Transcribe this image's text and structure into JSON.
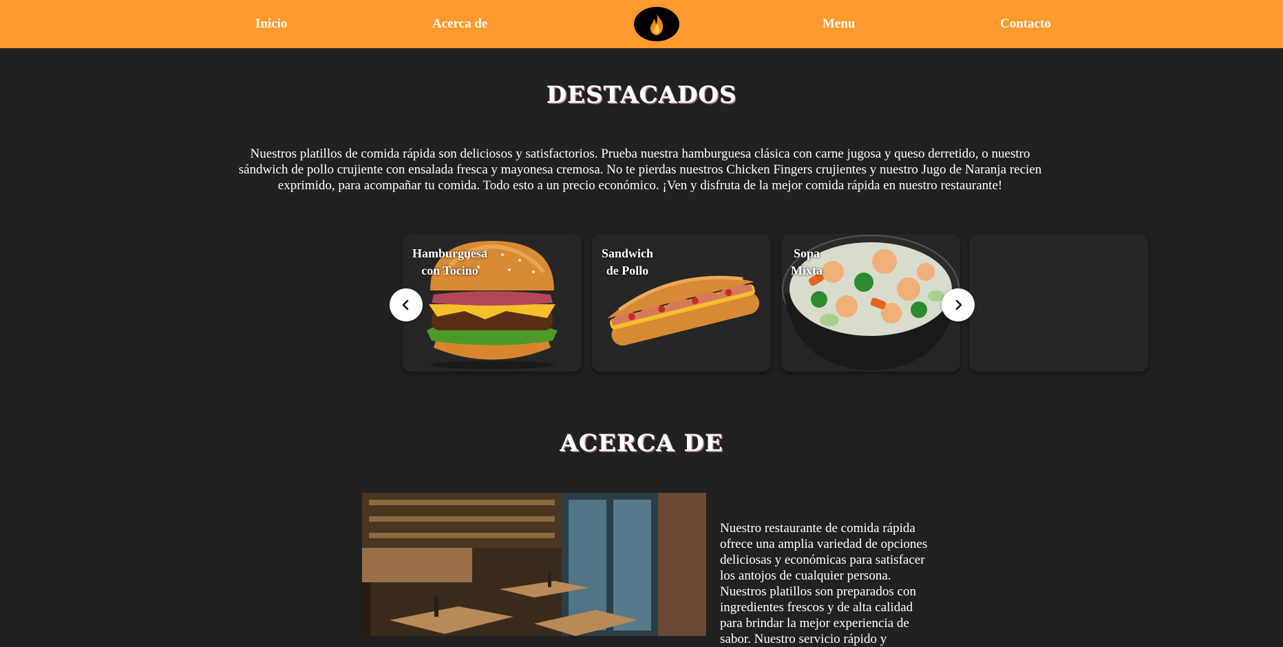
{
  "nav": {
    "items": [
      {
        "label": "Inicio"
      },
      {
        "label": "Acerca de"
      },
      {
        "label": "Menu"
      },
      {
        "label": "Contacto"
      }
    ],
    "logo_icon": "flame-icon",
    "background": "#ff9a2e"
  },
  "featured": {
    "title": "DESTACADOS",
    "description": "Nuestros platillos de comida rápida son deliciosos y satisfactorios. Prueba nuestra hamburguesa clásica con carne jugosa y queso derretido, o nuestro sándwich de pollo crujiente con ensalada fresca y mayonesa cremosa. No te pierdas nuestros Chicken Fingers crujientes y nuestro Jugo de Naranja recien exprimido, para acompañar tu comida. Todo esto a un precio económico. ¡Ven y disfruta de la mejor comida rápida en nuestro restaurante!",
    "cards": [
      {
        "line1": "Hamburguesa",
        "line2": "con Tocino"
      },
      {
        "line1": "Sandwich",
        "line2": "de Pollo"
      },
      {
        "line1": "Sopa",
        "line2": "Mixta"
      }
    ],
    "prev_icon": "chevron-left-icon",
    "next_icon": "chevron-right-icon"
  },
  "about": {
    "title": "ACERCA DE",
    "lines": [
      "Nuestro restaurante de comida rápida",
      "ofrece una amplia variedad de opciones",
      "deliciosas y económicas para satisfacer",
      "los antojos de cualquier persona.",
      "Nuestros platillos son preparados con",
      "ingredientes frescos y de alta calidad",
      "para brindar la mejor experiencia de",
      "sabor. Nuestro servicio rápido y"
    ]
  }
}
